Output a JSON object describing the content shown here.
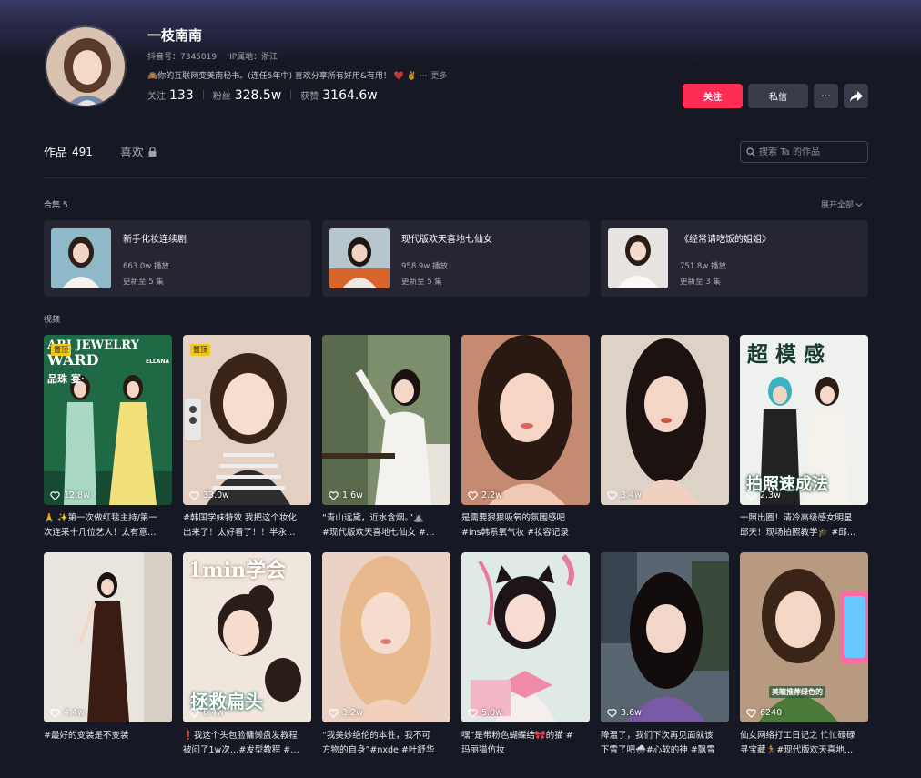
{
  "profile": {
    "name": "一枝南南",
    "douyin_id": "抖音号：7345019",
    "ip_location": "IP属地：浙江",
    "bio": "🙈你的互联网变美南秘书。(连任5年中) 喜欢分享所有好用&有用！ ❤️ ✌️ ···",
    "bio_more": "更多",
    "stats": {
      "following_label": "关注",
      "following": "133",
      "followers_label": "粉丝",
      "followers": "328.5w",
      "likes_label": "获赞",
      "likes": "3164.6w"
    },
    "buttons": {
      "follow": "关注",
      "message": "私信",
      "more": "···"
    }
  },
  "tabs": {
    "works_label": "作品",
    "works_count": "491",
    "likes_label": "喜欢"
  },
  "search": {
    "placeholder": "搜索 Ta 的作品"
  },
  "collections": {
    "title": "合集 5",
    "expand": "展开全部",
    "items": [
      {
        "title": "新手化妆连续剧",
        "plays": "663.0w 播放",
        "updated": "更新至 5 集"
      },
      {
        "title": "现代版欢天喜地七仙女",
        "plays": "958.9w 播放",
        "updated": "更新至 5 集"
      },
      {
        "title": "《经常请吃饭的姐姐》",
        "plays": "751.8w 播放",
        "updated": "更新至 3 集"
      }
    ]
  },
  "videos": {
    "title": "视频",
    "pin_label": "置顶",
    "items": [
      {
        "likes": "12.8w",
        "caption": "🙏 ✨第一次做红毯主持/第一\n次连采十几位艺人！太有意…",
        "pinned": true
      },
      {
        "likes": "33.0w",
        "caption": "#韩国学妹特效 我把这个妆化\n出来了！太好看了！！半永…",
        "pinned": true
      },
      {
        "likes": "1.6w",
        "caption": "“青山远黛，近水含烟。”⛰️\n#现代版欢天喜地七仙女 #…",
        "pinned": false
      },
      {
        "likes": "2.2w",
        "caption": "是需要狠狠吸氧的氛围感吧\n#ins韩系氧气妆 #妆容记录",
        "pinned": false
      },
      {
        "likes": "3.4w",
        "caption": "",
        "pinned": false
      },
      {
        "likes": "2.3w",
        "caption": "一照出圈！清冷高级感女明星\n邱天！现场拍照教学🎓 #邱…",
        "pinned": false
      },
      {
        "likes": "4.4w",
        "caption": "#最好的变装是不变装",
        "pinned": false
      },
      {
        "likes": "6.4w",
        "caption": "❗我这个头包脸慵懒盘发教程\n被问了1w次…#发型教程 #…",
        "pinned": false
      },
      {
        "likes": "3.2w",
        "caption": "“我美妙绝伦的本性，我不可\n方物的自身”#nxde #叶舒华",
        "pinned": false
      },
      {
        "likes": "5.0w",
        "caption": "嘿”是带粉色蝴蝶结🎀的猫 #\n玛丽猫仿妆",
        "pinned": false
      },
      {
        "likes": "3.6w",
        "caption": "降温了，我们下次再见面就该\n下雪了吧🌨️#心软的神 #飘雪",
        "pinned": false
      },
      {
        "likes": "6240",
        "caption": "仙女网络打工日记之 忙忙碌碌\n寻宝藏🏃#现代版欢天喜地…",
        "pinned": false
      }
    ]
  },
  "overlays": {
    "v1_top": "ARI JEWELRY",
    "v1_mid": "WARD",
    "v1_sub": "品珠 宴·",
    "v1_brand": "ELLANA",
    "v6_title": "超 模 感",
    "v6_bottom": "拍照速成法",
    "v8_top": "1min学会",
    "v8_bottom": "拯救扁头",
    "v12_tag": "美瞳推荐绿色的"
  },
  "colors": {
    "accent": "#fe2c55",
    "background": "#161823",
    "card": "#252632",
    "pin": "#f5c518"
  }
}
